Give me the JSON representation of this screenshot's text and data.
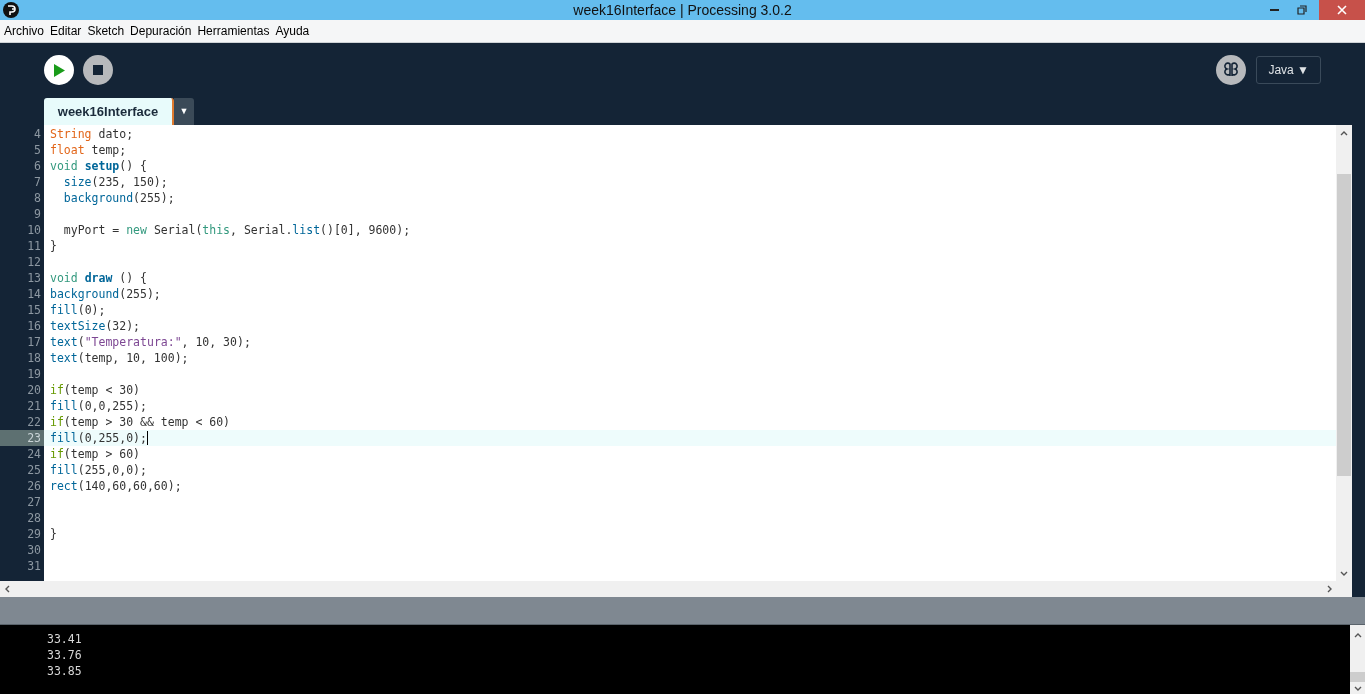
{
  "window": {
    "title": "week16Interface | Processing 3.0.2"
  },
  "menu": [
    "Archivo",
    "Editar",
    "Sketch",
    "Depuración",
    "Herramientas",
    "Ayuda"
  ],
  "mode": {
    "label": "Java ▼"
  },
  "tabs": [
    {
      "label": "week16Interface",
      "selected": true
    }
  ],
  "tab_menu": "▼",
  "editor": {
    "lines": [
      {
        "number": "4",
        "current": false,
        "tokens": [
          {
            "text": "String",
            "kind": "type"
          },
          {
            "text": " dato;",
            "kind": "plain"
          }
        ]
      },
      {
        "number": "5",
        "current": false,
        "tokens": [
          {
            "text": "float",
            "kind": "type"
          },
          {
            "text": " temp;",
            "kind": "plain"
          }
        ]
      },
      {
        "number": "6",
        "current": false,
        "tokens": [
          {
            "text": "void",
            "kind": "keyword"
          },
          {
            "text": " setup",
            "kind": "method"
          },
          {
            "text": "() {",
            "kind": "plain"
          }
        ]
      },
      {
        "number": "7",
        "current": false,
        "tokens": [
          {
            "text": "  size",
            "kind": "function"
          },
          {
            "text": "(235, 150);",
            "kind": "plain"
          }
        ]
      },
      {
        "number": "8",
        "current": false,
        "tokens": [
          {
            "text": "  background",
            "kind": "function"
          },
          {
            "text": "(255);",
            "kind": "plain"
          }
        ]
      },
      {
        "number": "9",
        "current": false
      },
      {
        "number": "10",
        "current": false,
        "tokens": [
          {
            "text": "  myPort = ",
            "kind": "plain"
          },
          {
            "text": "new",
            "kind": "literal"
          },
          {
            "text": " Serial(",
            "kind": "plain"
          },
          {
            "text": "this",
            "kind": "literal"
          },
          {
            "text": ", Serial.",
            "kind": "plain"
          },
          {
            "text": "list",
            "kind": "function"
          },
          {
            "text": "()[0], 9600);",
            "kind": "plain"
          }
        ]
      },
      {
        "number": "11",
        "current": false,
        "tokens": [
          {
            "text": "}",
            "kind": "plain"
          }
        ]
      },
      {
        "number": "12",
        "current": false
      },
      {
        "number": "13",
        "current": false,
        "tokens": [
          {
            "text": "void",
            "kind": "keyword"
          },
          {
            "text": " draw",
            "kind": "method"
          },
          {
            "text": " () {",
            "kind": "plain"
          }
        ]
      },
      {
        "number": "14",
        "current": false,
        "tokens": [
          {
            "text": "background",
            "kind": "function"
          },
          {
            "text": "(255);",
            "kind": "plain"
          }
        ]
      },
      {
        "number": "15",
        "current": false,
        "tokens": [
          {
            "text": "fill",
            "kind": "function"
          },
          {
            "text": "(0);",
            "kind": "plain"
          }
        ]
      },
      {
        "number": "16",
        "current": false,
        "tokens": [
          {
            "text": "textSize",
            "kind": "function"
          },
          {
            "text": "(32);",
            "kind": "plain"
          }
        ]
      },
      {
        "number": "17",
        "current": false,
        "tokens": [
          {
            "text": "text",
            "kind": "function"
          },
          {
            "text": "(",
            "kind": "plain"
          },
          {
            "text": "\"Temperatura:\"",
            "kind": "string"
          },
          {
            "text": ", 10, 30);",
            "kind": "plain"
          }
        ]
      },
      {
        "number": "18",
        "current": false,
        "tokens": [
          {
            "text": "text",
            "kind": "function"
          },
          {
            "text": "(temp, 10, 100);",
            "kind": "plain"
          }
        ]
      },
      {
        "number": "19",
        "current": false
      },
      {
        "number": "20",
        "current": false,
        "tokens": [
          {
            "text": "if",
            "kind": "control"
          },
          {
            "text": "(temp < 30)",
            "kind": "plain"
          }
        ]
      },
      {
        "number": "21",
        "current": false,
        "tokens": [
          {
            "text": "fill",
            "kind": "function"
          },
          {
            "text": "(0,0,255);",
            "kind": "plain"
          }
        ]
      },
      {
        "number": "22",
        "current": false,
        "tokens": [
          {
            "text": "if",
            "kind": "control"
          },
          {
            "text": "(temp > 30 && temp < 60)",
            "kind": "plain"
          }
        ]
      },
      {
        "number": "23",
        "current": true,
        "tokens": [
          {
            "text": "fill",
            "kind": "function"
          },
          {
            "text": "(0,255,0);",
            "kind": "plain"
          }
        ]
      },
      {
        "number": "24",
        "current": false,
        "tokens": [
          {
            "text": "if",
            "kind": "control"
          },
          {
            "text": "(temp > 60)",
            "kind": "plain"
          }
        ]
      },
      {
        "number": "25",
        "current": false,
        "tokens": [
          {
            "text": "fill",
            "kind": "function"
          },
          {
            "text": "(255,0,0);",
            "kind": "plain"
          }
        ]
      },
      {
        "number": "26",
        "current": false,
        "tokens": [
          {
            "text": "rect",
            "kind": "function"
          },
          {
            "text": "(140,60,60,60);",
            "kind": "plain"
          }
        ]
      },
      {
        "number": "27",
        "current": false
      },
      {
        "number": "28",
        "current": false
      },
      {
        "number": "29",
        "current": false,
        "tokens": [
          {
            "text": "}",
            "kind": "plain"
          }
        ]
      },
      {
        "number": "30",
        "current": false
      },
      {
        "number": "31",
        "current": false
      }
    ]
  },
  "console": {
    "lines": [
      "33.41",
      "33.76",
      "33.85"
    ]
  }
}
